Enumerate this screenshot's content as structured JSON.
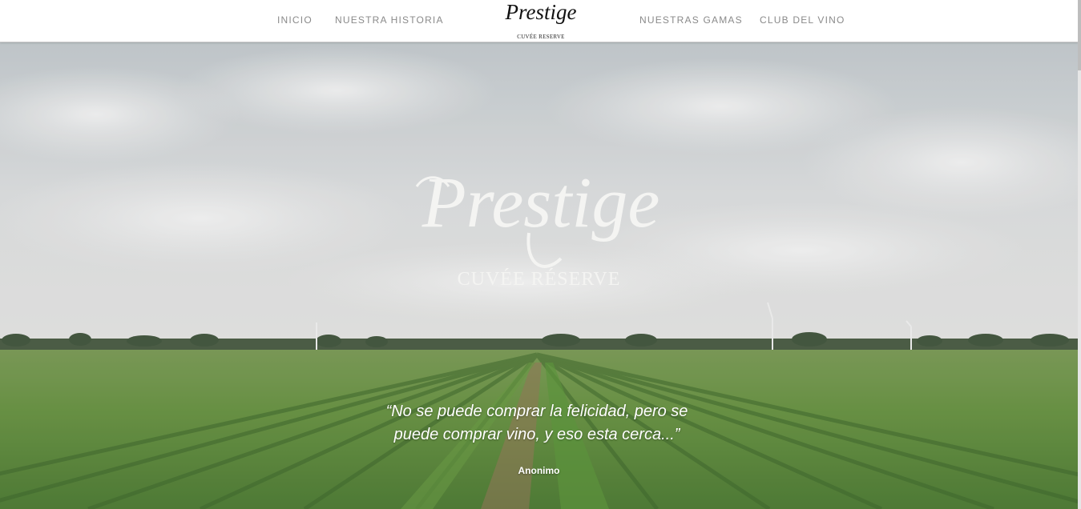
{
  "nav": {
    "left_links": [
      "INICIO",
      "NUESTRA HISTORIA"
    ],
    "right_links": [
      "NUESTRAS GAMAS",
      "CLUB DEL VINO"
    ],
    "logo_script": "Prestige",
    "logo_sub": "CUVÉE RESERVE"
  },
  "hero": {
    "logo_script": "Prestige",
    "logo_sub": "CUVÉE RÉSERVE",
    "quote": "“No se puede comprar la felicidad, pero se puede comprar vino, y eso esta cerca...”",
    "author": "Anonimo"
  },
  "colors": {
    "nav_text": "#8a8a8a",
    "sky": "#c9cccf",
    "vines": "#5f8a3a",
    "hero_text": "#ffffff"
  }
}
